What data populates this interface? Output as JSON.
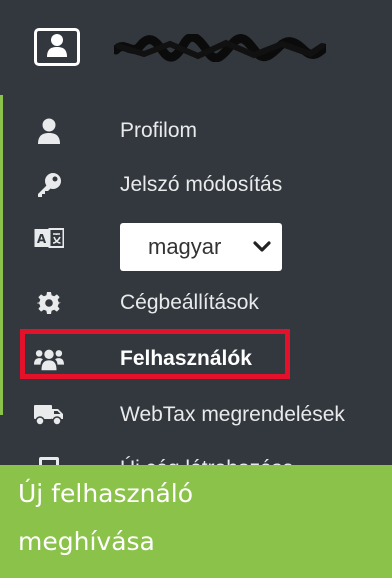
{
  "header": {
    "user_icon": "user-icon",
    "user_name": "████████████"
  },
  "menu": {
    "items": [
      {
        "label": "Profilom",
        "icon": "user-icon"
      },
      {
        "label": "Jelszó módosítás",
        "icon": "key-icon"
      },
      {
        "label": "Cégbeállítások",
        "icon": "gear-icon"
      },
      {
        "label": "Felhasználók",
        "icon": "users-icon"
      },
      {
        "label": "WebTax megrendelések",
        "icon": "truck-icon"
      },
      {
        "label": "Új cég létrehozása",
        "icon": "calculator-icon"
      }
    ],
    "language": {
      "icon": "language-icon",
      "selected": "magyar"
    }
  },
  "banner": {
    "line1": "Új felhasználó",
    "line2": "meghívása"
  },
  "colors": {
    "sidebar_bg": "#33383e",
    "accent_green": "#8bc34a",
    "highlight_red": "#e3112a"
  }
}
